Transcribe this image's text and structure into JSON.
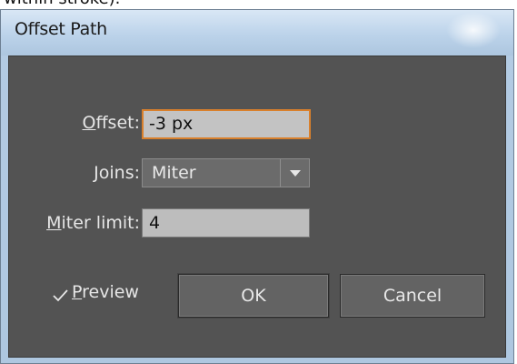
{
  "page": {
    "top_cut_text": "within stroke)."
  },
  "dialog": {
    "title": "Offset Path",
    "offset": {
      "label_mnemonic": "O",
      "label_rest": "ffset:",
      "value": "-3 px"
    },
    "joins": {
      "label_mnemonic": "J",
      "label_rest": "oins:",
      "selected": "Miter"
    },
    "miter_limit": {
      "label_mnemonic": "M",
      "label_rest": "iter limit:",
      "value": "4"
    },
    "preview": {
      "label_mnemonic": "P",
      "label_rest": "review",
      "checked": true
    },
    "buttons": {
      "ok": "OK",
      "cancel": "Cancel"
    }
  },
  "colors": {
    "panel_bg": "#535353",
    "focus_border": "#d9802c",
    "titlebar": "#bcd3ea"
  }
}
